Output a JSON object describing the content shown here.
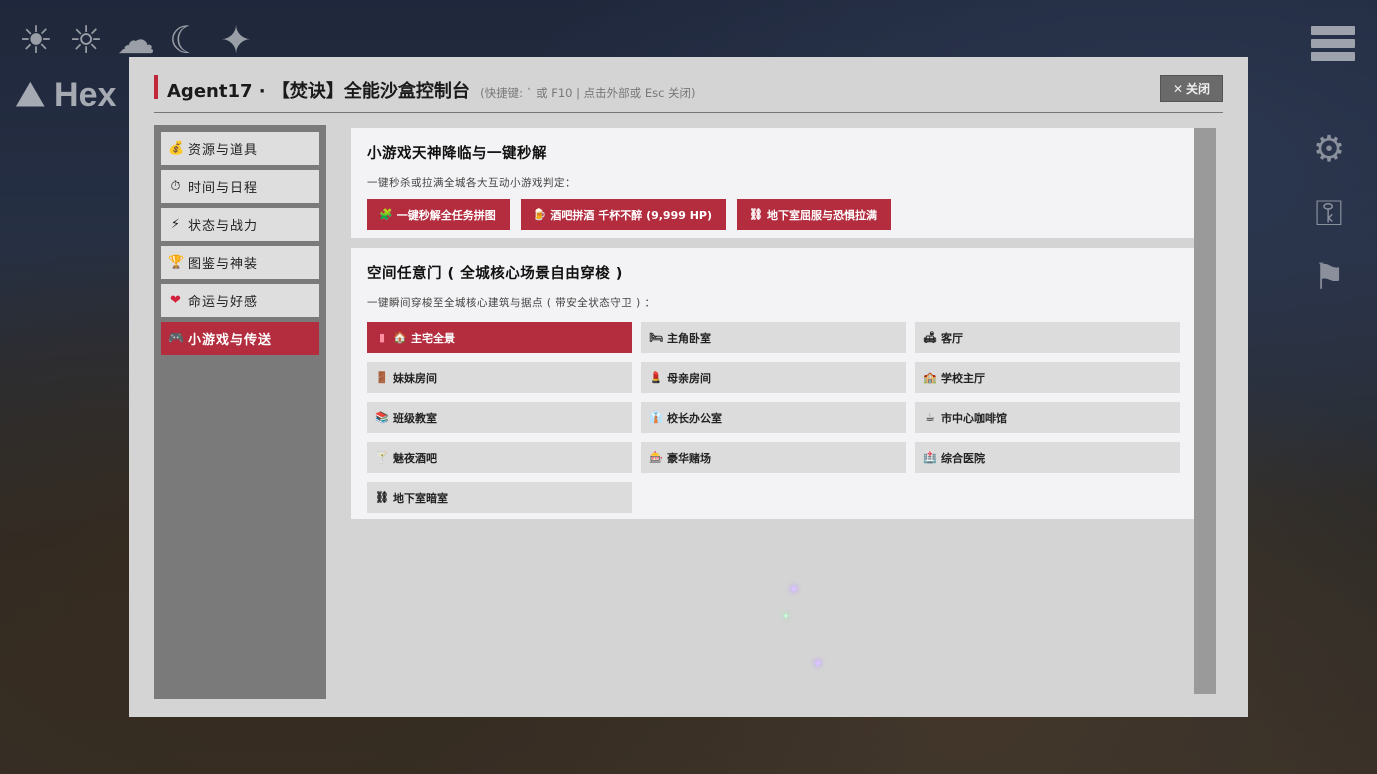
{
  "hud": {
    "weather_icons": [
      "☀",
      "☼",
      "☁",
      "☾",
      "✦"
    ],
    "logo_text": "Hex",
    "side_icons": [
      "⚙",
      "⚿",
      "⚑"
    ]
  },
  "modal": {
    "title": "Agent17 · 【焚诀】全能沙盒控制台",
    "hint": "(快捷键: ` 或 F10 | 点击外部或 Esc 关闭)",
    "close_label": "关闭",
    "close_icon": "✕"
  },
  "sidebar": {
    "items": [
      {
        "icon": "💰",
        "label": "资源与道具"
      },
      {
        "icon": "⏱",
        "label": "时间与日程"
      },
      {
        "icon": "⚡",
        "label": "状态与战力"
      },
      {
        "icon": "🏆",
        "label": "图鉴与神装"
      },
      {
        "icon": "❤",
        "label": "命运与好感"
      },
      {
        "icon": "🎮",
        "label": "小游戏与传送"
      }
    ],
    "active_index": 5
  },
  "minigame": {
    "title": "小游戏天神降临与一键秒解",
    "desc": "一键秒杀或拉满全城各大互动小游戏判定：",
    "buttons": [
      {
        "icon": "🧩",
        "label": "一键秒解全任务拼图"
      },
      {
        "icon": "🍺",
        "label": "酒吧拼酒 千杯不醉 (9,999 HP)"
      },
      {
        "icon": "⛓",
        "label": "地下室屈服与恐惧拉满"
      }
    ]
  },
  "teleport": {
    "title": "空间任意门 ( 全城核心场景自由穿梭 )",
    "desc": "一键瞬间穿梭至全城核心建筑与据点 ( 带安全状态守卫 ) ：",
    "locations": [
      {
        "icon": "🏠",
        "label": "主宅全景",
        "active": true
      },
      {
        "icon": "🛏",
        "label": "主角卧室"
      },
      {
        "icon": "🛋",
        "label": "客厅"
      },
      {
        "icon": "🚪",
        "label": "妹妹房间"
      },
      {
        "icon": "💄",
        "label": "母亲房间"
      },
      {
        "icon": "🏫",
        "label": "学校主厅"
      },
      {
        "icon": "📚",
        "label": "班级教室"
      },
      {
        "icon": "👔",
        "label": "校长办公室"
      },
      {
        "icon": "☕",
        "label": "市中心咖啡馆"
      },
      {
        "icon": "🍸",
        "label": "魅夜酒吧"
      },
      {
        "icon": "🎰",
        "label": "豪华赌场"
      },
      {
        "icon": "🏥",
        "label": "综合医院"
      },
      {
        "icon": "⛓",
        "label": "地下室暗室"
      }
    ]
  }
}
